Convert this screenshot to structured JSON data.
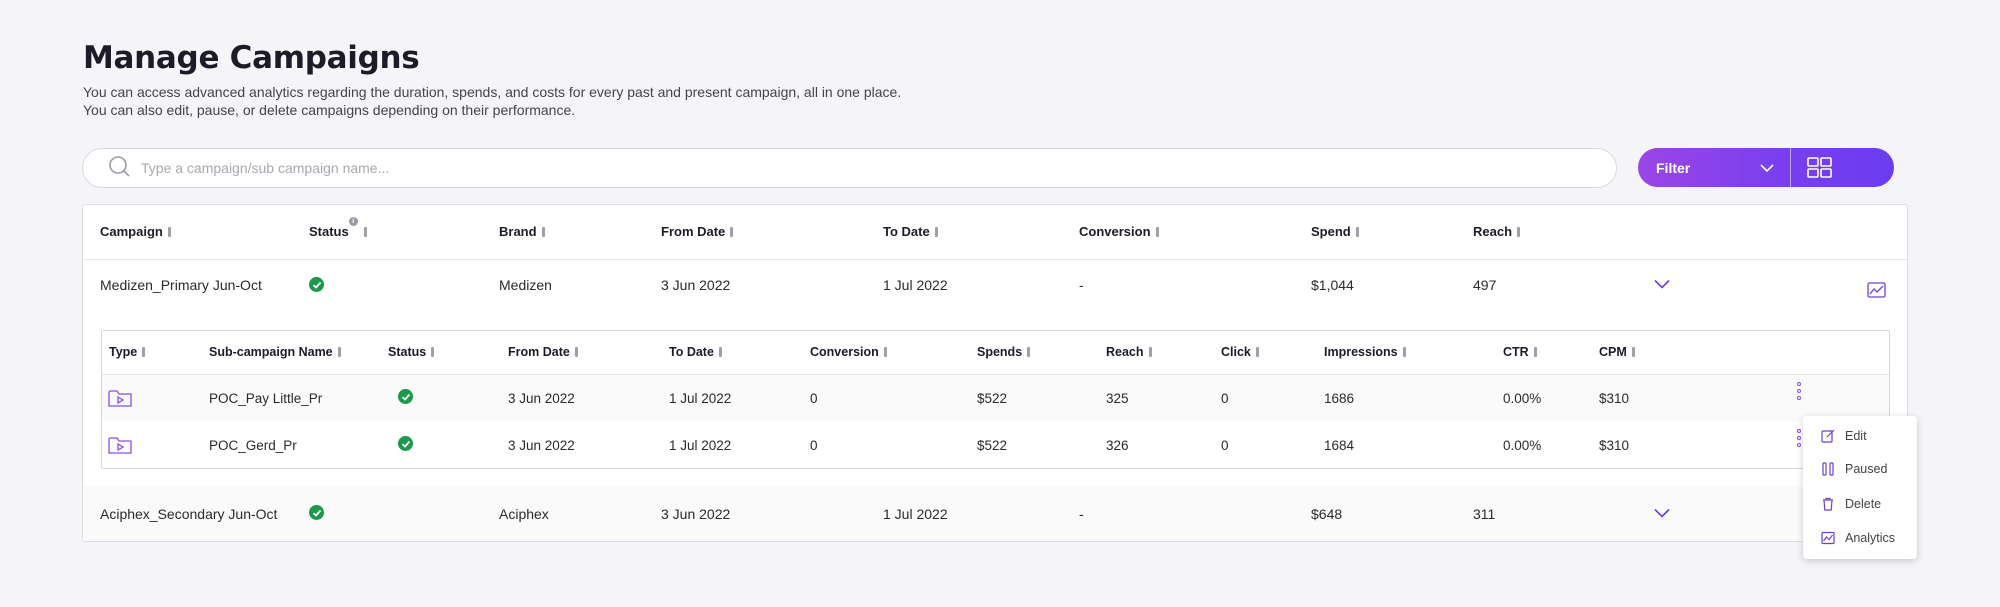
{
  "header": {
    "title": "Manage Campaigns",
    "description_line1": "You can access advanced analytics regarding the duration, spends, and costs for every past and present campaign, all in one place.",
    "description_line2": "You can also edit, pause, or delete campaigns depending on their performance."
  },
  "search": {
    "placeholder": "Type a campaign/sub campaign name..."
  },
  "toolbar": {
    "filter_label": "Filter"
  },
  "colors": {
    "accent": "#7a3fee",
    "gradient_start": "#9b45e6",
    "success": "#1b9a4b"
  },
  "table": {
    "columns": [
      "Campaign",
      "Status",
      "Brand",
      "From Date",
      "To Date",
      "Conversion",
      "Spend",
      "Reach"
    ],
    "rows": [
      {
        "campaign": "Medizen_Primary Jun-Oct",
        "status": "active",
        "brand": "Medizen",
        "from": "3 Jun 2022",
        "to": "1 Jul 2022",
        "conversion": "-",
        "spend": "$1,044",
        "reach": "497"
      },
      {
        "campaign": "Aciphex_Secondary Jun-Oct",
        "status": "active",
        "brand": "Aciphex",
        "from": "3 Jun 2022",
        "to": "1 Jul 2022",
        "conversion": "-",
        "spend": "$648",
        "reach": "311"
      }
    ]
  },
  "subtable": {
    "columns": [
      "Type",
      "Sub-campaign Name",
      "Status",
      "From Date",
      "To Date",
      "Conversion",
      "Spends",
      "Reach",
      "Click",
      "Impressions",
      "CTR",
      "CPM"
    ],
    "rows": [
      {
        "type": "video-folder-icon",
        "name": "POC_Pay Little_Pr",
        "status": "active",
        "from": "3 Jun 2022",
        "to": "1 Jul 2022",
        "conversion": "0",
        "spends": "$522",
        "reach": "325",
        "click": "0",
        "impressions": "1686",
        "ctr": "0.00%",
        "cpm": "$310"
      },
      {
        "type": "video-folder-icon",
        "name": "POC_Gerd_Pr",
        "status": "active",
        "from": "3 Jun 2022",
        "to": "1 Jul 2022",
        "conversion": "0",
        "spends": "$522",
        "reach": "326",
        "click": "0",
        "impressions": "1684",
        "ctr": "0.00%",
        "cpm": "$310"
      }
    ]
  },
  "context_menu": {
    "items": [
      {
        "label": "Edit",
        "icon": "edit-icon"
      },
      {
        "label": "Paused",
        "icon": "pause-icon"
      },
      {
        "label": "Delete",
        "icon": "trash-icon"
      },
      {
        "label": "Analytics",
        "icon": "analytics-icon"
      }
    ]
  }
}
